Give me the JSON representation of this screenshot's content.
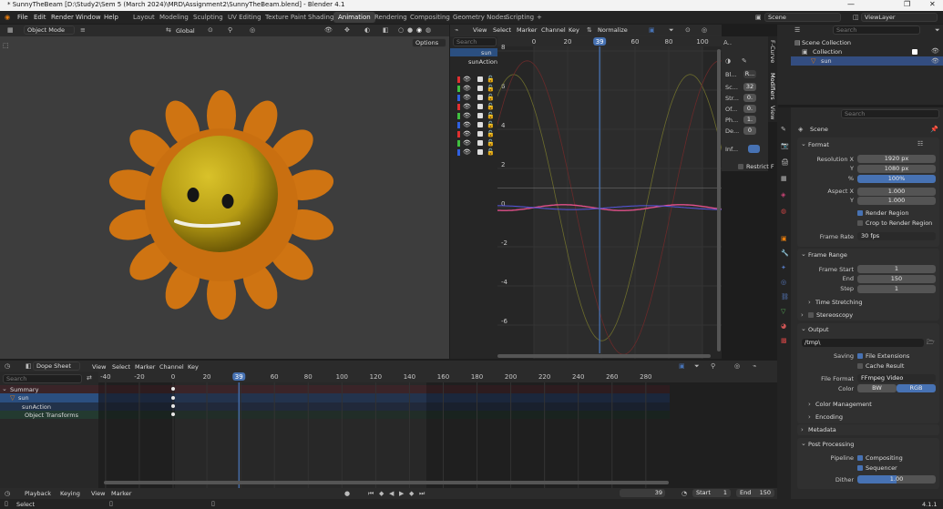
{
  "window": {
    "title": "* SunnyTheBeam [D:\\Study2\\Sem 5 (March 2024)\\MRD\\Assignment2\\SunnyTheBeam.blend] - Blender 4.1",
    "minimize": "—",
    "maximize": "❐",
    "close": "✕"
  },
  "menu": [
    "File",
    "Edit",
    "Render",
    "Window",
    "Help"
  ],
  "workspaces": [
    "Layout",
    "Modeling",
    "Sculpting",
    "UV Editing",
    "Texture Paint",
    "Shading",
    "Animation",
    "Rendering",
    "Compositing",
    "Geometry Nodes",
    "Scripting",
    "+"
  ],
  "active_workspace": "Animation",
  "scene_name": "Scene",
  "view_layer": "ViewLayer",
  "viewport": {
    "mode": "Object Mode",
    "transform": "Global",
    "options": "Options"
  },
  "graph_editor": {
    "menus": [
      "View",
      "Select",
      "Marker",
      "Channel",
      "Key"
    ],
    "normalize": "Normalize",
    "search_placeholder": "Search",
    "frame_ticks": [
      "0",
      "20",
      "40",
      "60",
      "80",
      "100"
    ],
    "current_frame": "39",
    "value_ticks": [
      "8",
      "6",
      "4",
      "2",
      "0",
      "-2",
      "-4",
      "-6"
    ],
    "channels": {
      "object": "sun",
      "action": "sunAction"
    },
    "side_tabs": [
      "F-Curve",
      "Modifiers",
      "View"
    ],
    "modifier": {
      "blend_label": "Bl...",
      "blend_value": "R...",
      "scale_label": "Sc...",
      "scale_value": "32",
      "strength_label": "Str...",
      "strength_value": "0.",
      "offset_label": "Of...",
      "offset_value": "0.",
      "phase_label": "Ph...",
      "phase_value": "1.",
      "depth_label": "De...",
      "depth_value": "0",
      "influence_label": "Inf...",
      "restrict": "Restrict F"
    }
  },
  "outliner": {
    "search_placeholder": "Search",
    "scene_collection": "Scene Collection",
    "collection": "Collection",
    "object": "sun"
  },
  "properties": {
    "search_placeholder": "Search",
    "scene": "Scene",
    "format": {
      "title": "Format",
      "res_x_label": "Resolution X",
      "res_x": "1920 px",
      "res_y_label": "Y",
      "res_y": "1080 px",
      "pct_label": "%",
      "pct": "100%",
      "aspect_x_label": "Aspect X",
      "aspect_x": "1.000",
      "aspect_y_label": "Y",
      "aspect_y": "1.000",
      "render_region": "Render Region",
      "crop": "Crop to Render Region",
      "frame_rate_label": "Frame Rate",
      "frame_rate": "30 fps"
    },
    "frame_range": {
      "title": "Frame Range",
      "start_label": "Frame Start",
      "start": "1",
      "end_label": "End",
      "end": "150",
      "step_label": "Step",
      "step": "1",
      "time_stretching": "Time Stretching"
    },
    "stereoscopy": "Stereoscopy",
    "output": {
      "title": "Output",
      "path": "/tmp\\",
      "saving_label": "Saving",
      "file_extensions": "File Extensions",
      "cache_result": "Cache Result",
      "file_format_label": "File Format",
      "file_format": "FFmpeg Video",
      "color_label": "Color",
      "bw": "BW",
      "rgb": "RGB",
      "color_management": "Color Management",
      "encoding": "Encoding"
    },
    "metadata": "Metadata",
    "post_processing": {
      "title": "Post Processing",
      "pipeline_label": "Pipeline",
      "compositing": "Compositing",
      "sequencer": "Sequencer",
      "dither_label": "Dither",
      "dither": "1.00"
    }
  },
  "dopesheet": {
    "mode": "Dope Sheet",
    "menus": [
      "View",
      "Select",
      "Marker",
      "Channel",
      "Key"
    ],
    "search_placeholder": "Search",
    "ticks": [
      "-40",
      "-20",
      "0",
      "20",
      "40",
      "60",
      "80",
      "100",
      "120",
      "140",
      "160",
      "180",
      "200",
      "220",
      "240",
      "260",
      "280"
    ],
    "current_frame": "39",
    "channels": [
      "Summary",
      "sun",
      "sunAction",
      "Object Transforms"
    ]
  },
  "timeline": {
    "menus": [
      "Playback",
      "Keying",
      "View",
      "Marker"
    ],
    "current": "39",
    "start_label": "Start",
    "start": "1",
    "end_label": "End",
    "end": "150"
  },
  "status": {
    "select": "Select",
    "version": "4.1.1"
  }
}
